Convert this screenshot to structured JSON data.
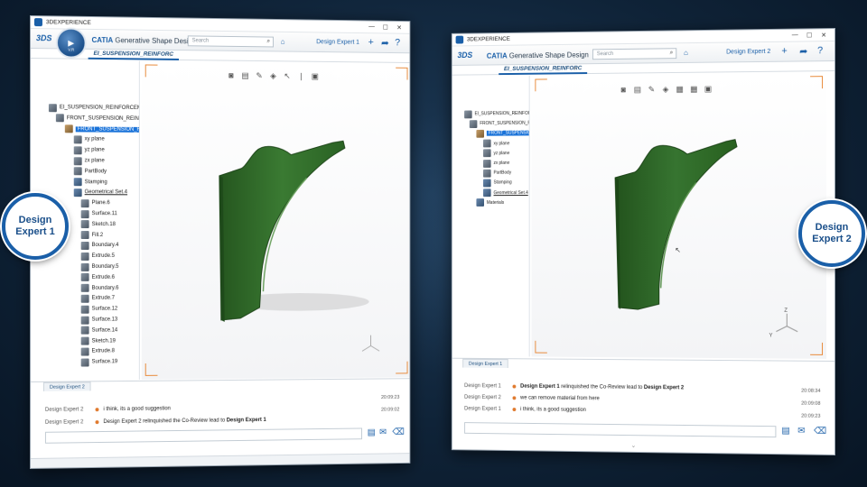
{
  "left_window": {
    "title": "3DEXPERIENCE",
    "app_name_brand": "CATIA",
    "app_name": "Generative Shape Design",
    "compass_version": "V.R",
    "search_placeholder": "Search",
    "user": "Design Expert 1",
    "doc_tab": "EI_SUSPENSION_REINFORC",
    "tree": [
      {
        "label": "EI_SUSPENSION_REINFORCEM",
        "icon": "product"
      },
      {
        "label": "FRONT_SUSPENSION_REIN",
        "icon": "product"
      },
      {
        "label": "FRONT_SUSPENSION_RE",
        "icon": "part",
        "selected": true
      },
      {
        "label": "xy plane",
        "icon": "plane"
      },
      {
        "label": "yz plane",
        "icon": "plane"
      },
      {
        "label": "zx plane",
        "icon": "plane"
      },
      {
        "label": "PartBody",
        "icon": "body"
      },
      {
        "label": "Stamping",
        "icon": "geo"
      },
      {
        "label": "Geometrical Set.4",
        "icon": "geo",
        "underline": true
      },
      {
        "label": "Plane.6",
        "icon": "plane"
      },
      {
        "label": "Surface.11",
        "icon": "surface"
      },
      {
        "label": "Sketch.18",
        "icon": "sketch"
      },
      {
        "label": "Fill.2",
        "icon": "surface"
      },
      {
        "label": "Boundary.4",
        "icon": "surface"
      },
      {
        "label": "Extrude.5",
        "icon": "surface"
      },
      {
        "label": "Boundary.5",
        "icon": "surface"
      },
      {
        "label": "Extrude.6",
        "icon": "surface"
      },
      {
        "label": "Boundary.6",
        "icon": "surface"
      },
      {
        "label": "Extrude.7",
        "icon": "surface"
      },
      {
        "label": "Surface.12",
        "icon": "surface"
      },
      {
        "label": "Surface.13",
        "icon": "surface"
      },
      {
        "label": "Surface.14",
        "icon": "surface"
      },
      {
        "label": "Sketch.19",
        "icon": "sketch"
      },
      {
        "label": "Extrude.8",
        "icon": "surface"
      },
      {
        "label": "Surface.19",
        "icon": "surface"
      }
    ],
    "chat_tab": "Design Expert 2",
    "messages": [
      {
        "who": "Design Expert 2",
        "text": "i think, its a good suggestion",
        "time": "20:09:23"
      },
      {
        "who": "Design Expert 2",
        "text_pre": "Design Expert 2 relinquished the Co-Review lead to ",
        "text_bold": "Design Expert 1",
        "time": "20:09:02"
      }
    ],
    "badge": "Design Expert 1"
  },
  "right_window": {
    "title": "3DEXPERIENCE",
    "app_name_brand": "CATIA",
    "app_name": "Generative Shape Design",
    "compass_version": "V.R",
    "search_placeholder": "Search",
    "user": "Design Expert 2",
    "doc_tab": "EI_SUSPENSION_REINFORC",
    "tree": [
      {
        "label": "EI_SUSPENSION_REINFORCEM",
        "icon": "product"
      },
      {
        "label": "FRONT_SUSPENSION_REIN",
        "icon": "product"
      },
      {
        "label": "FRONT_SUSPENSION_",
        "icon": "part",
        "selected": true
      },
      {
        "label": "xy plane",
        "icon": "plane"
      },
      {
        "label": "yz plane",
        "icon": "plane"
      },
      {
        "label": "zx plane",
        "icon": "plane"
      },
      {
        "label": "PartBody",
        "icon": "body"
      },
      {
        "label": "Stamping",
        "icon": "geo"
      },
      {
        "label": "Geometrical Set.4",
        "icon": "geo",
        "underline": true
      },
      {
        "label": "Materials",
        "icon": "geo"
      }
    ],
    "chat_tab": "Design Expert 1",
    "messages": [
      {
        "who": "Design Expert 1",
        "text_pre": "relinquished the Co-Review lead to ",
        "text_bold": "Design Expert 2",
        "bold_first": "Design Expert 1",
        "time": "20:08:34"
      },
      {
        "who": "Design Expert 2",
        "text": "we can remove material from here",
        "time": "20:09:08"
      },
      {
        "who": "Design Expert 1",
        "text": "i think, its a good suggestion",
        "time": "20:09:23"
      }
    ],
    "badge": "Design Expert 2"
  },
  "axis_labels": {
    "z": "Z",
    "y": "Y"
  },
  "colors": {
    "brand": "#1a5fa8",
    "model": "#2f6b2a",
    "selection": "#1a73d9",
    "viewport_frame": "#e88a3a"
  }
}
